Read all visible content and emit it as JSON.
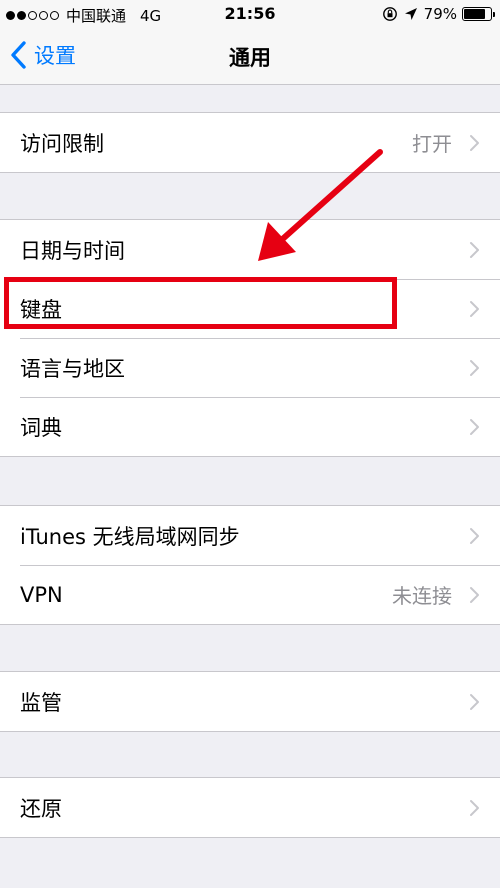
{
  "status_bar": {
    "carrier": "中国联通",
    "network": "4G",
    "time": "21:56",
    "battery": "79%",
    "battery_level": 0.79,
    "signal": {
      "filled": 2,
      "total": 5
    },
    "icons": [
      "orientation-lock-icon",
      "location-arrow-icon",
      "battery-icon"
    ]
  },
  "nav": {
    "back_label": "设置",
    "title": "通用"
  },
  "groups": [
    {
      "rows": [
        {
          "label": "访问限制",
          "value": "打开"
        }
      ]
    },
    {
      "rows": [
        {
          "label": "日期与时间",
          "value": ""
        },
        {
          "label": "键盘",
          "value": ""
        },
        {
          "label": "语言与地区",
          "value": ""
        },
        {
          "label": "词典",
          "value": ""
        }
      ]
    },
    {
      "rows": [
        {
          "label": "iTunes 无线局域网同步",
          "value": ""
        },
        {
          "label": "VPN",
          "value": "未连接"
        }
      ]
    },
    {
      "rows": [
        {
          "label": "监管",
          "value": ""
        }
      ]
    },
    {
      "rows": [
        {
          "label": "还原",
          "value": ""
        }
      ]
    }
  ],
  "annotation": {
    "color": "#e60012",
    "target": "键盘"
  },
  "colors": {
    "accent": "#007aff",
    "background": "#efeff4",
    "secondary_text": "#8e8e93",
    "separator": "#c8c7cc"
  }
}
